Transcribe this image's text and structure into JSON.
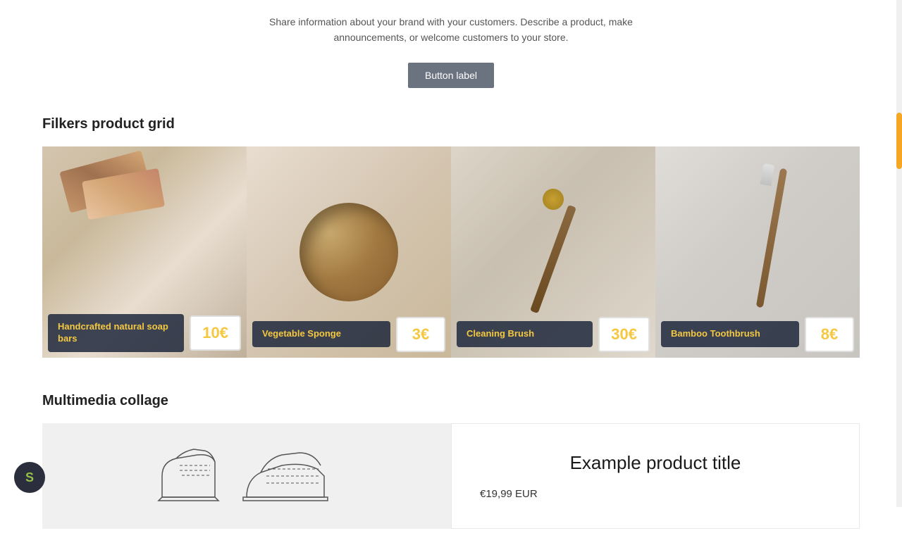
{
  "header": {
    "description": "Share information about your brand with your customers. Describe a product, make announcements, or welcome customers to your store.",
    "button_label": "Button label"
  },
  "product_grid": {
    "section_title": "Filkers product grid",
    "products": [
      {
        "id": "soap",
        "name": "Handcrafted natural soap bars",
        "price": "10€",
        "img_type": "soap"
      },
      {
        "id": "sponge",
        "name": "Vegetable Sponge",
        "price": "3€",
        "img_type": "sponge"
      },
      {
        "id": "brush",
        "name": "Cleaning Brush",
        "price": "30€",
        "img_type": "brush"
      },
      {
        "id": "toothbrush",
        "name": "Bamboo Toothbrush",
        "price": "8€",
        "img_type": "toothbrush"
      }
    ]
  },
  "multimedia": {
    "section_title": "Multimedia collage",
    "product": {
      "title": "Example product title",
      "price": "€19,99 EUR"
    }
  },
  "shopify": {
    "badge_letter": "S"
  }
}
